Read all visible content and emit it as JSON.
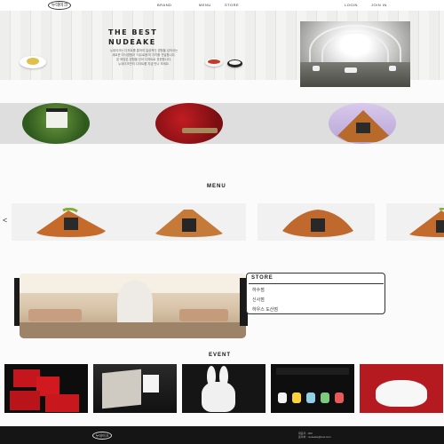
{
  "header": {
    "logo_text": "누데이크",
    "nav": [
      "BRAND",
      "MENU",
      "STORE",
      "LOGIN",
      "JOIN IN"
    ]
  },
  "hero": {
    "title_line1": "THE BEST",
    "title_line2": "NUDEAKE",
    "desc_line1": "누데이크는 디저트를 통하여 일상적인 경험을 넘어서는",
    "desc_line2": "새로운 미식경험과 '자유로움'의 가치를 전달합니다.",
    "desc_line3": "본 매장은 경험을 담아 디저트로 표현합니다.",
    "desc_line4": "누데이크만의 디저트를 지금 만나 보세요."
  },
  "menu": {
    "title": "MENU",
    "prev_arrow": "<"
  },
  "store": {
    "title": "STORE",
    "items": [
      "하수점",
      "신사점",
      "하우스 도산점"
    ]
  },
  "event": {
    "title": "EVENT"
  },
  "footer": {
    "logo_text": "누데이크",
    "info_line1": "대표자 : 000",
    "info_line2": "문의처 : nudeake@test.com"
  },
  "colors": {
    "background": "#fbfbfb",
    "band": "#dedede",
    "footer": "#151515"
  },
  "icons": {
    "prev": "chevron-left-icon"
  }
}
